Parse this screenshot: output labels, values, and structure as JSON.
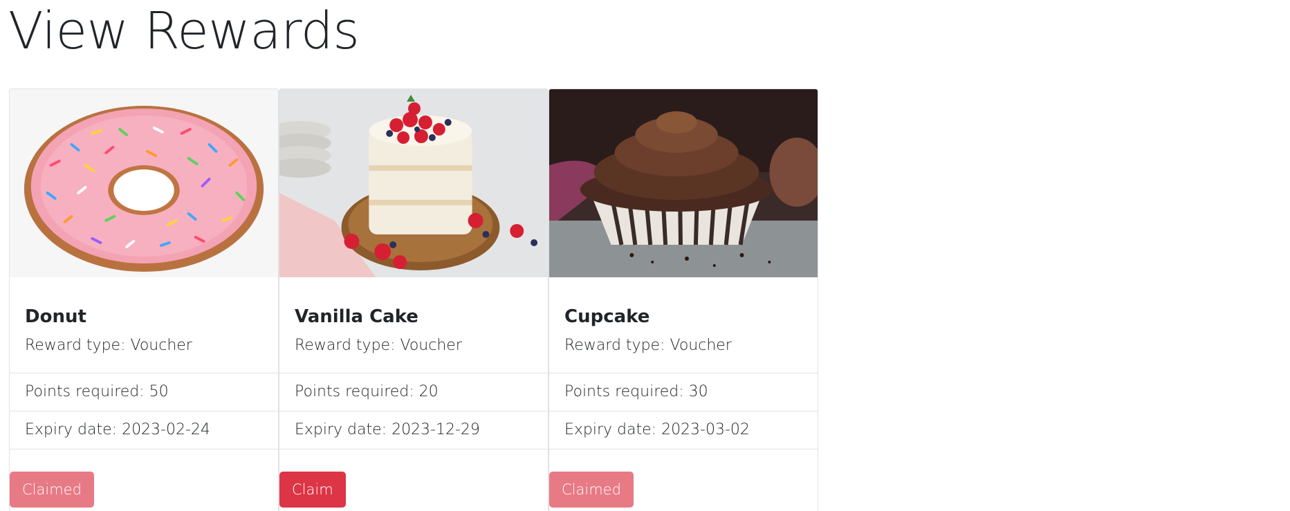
{
  "page": {
    "title": "View Rewards"
  },
  "rewards": [
    {
      "name": "Donut",
      "image_icon": "donut-image",
      "reward_type": "Reward type: Voucher",
      "points": "Points required: 50",
      "expiry": "Expiry date: 2023-02-24",
      "button_label": "Claimed",
      "claimed": true
    },
    {
      "name": "Vanilla Cake",
      "image_icon": "vanilla-cake-image",
      "reward_type": "Reward type: Voucher",
      "points": "Points required: 20",
      "expiry": "Expiry date: 2023-12-29",
      "button_label": "Claim",
      "claimed": false
    },
    {
      "name": "Cupcake",
      "image_icon": "cupcake-image",
      "reward_type": "Reward type: Voucher",
      "points": "Points required: 30",
      "expiry": "Expiry date: 2023-03-02",
      "button_label": "Claimed",
      "claimed": true
    }
  ],
  "colors": {
    "button": "#dc3545",
    "button_disabled": "#e77a85",
    "border": "#dee2e6",
    "text": "#212529"
  }
}
